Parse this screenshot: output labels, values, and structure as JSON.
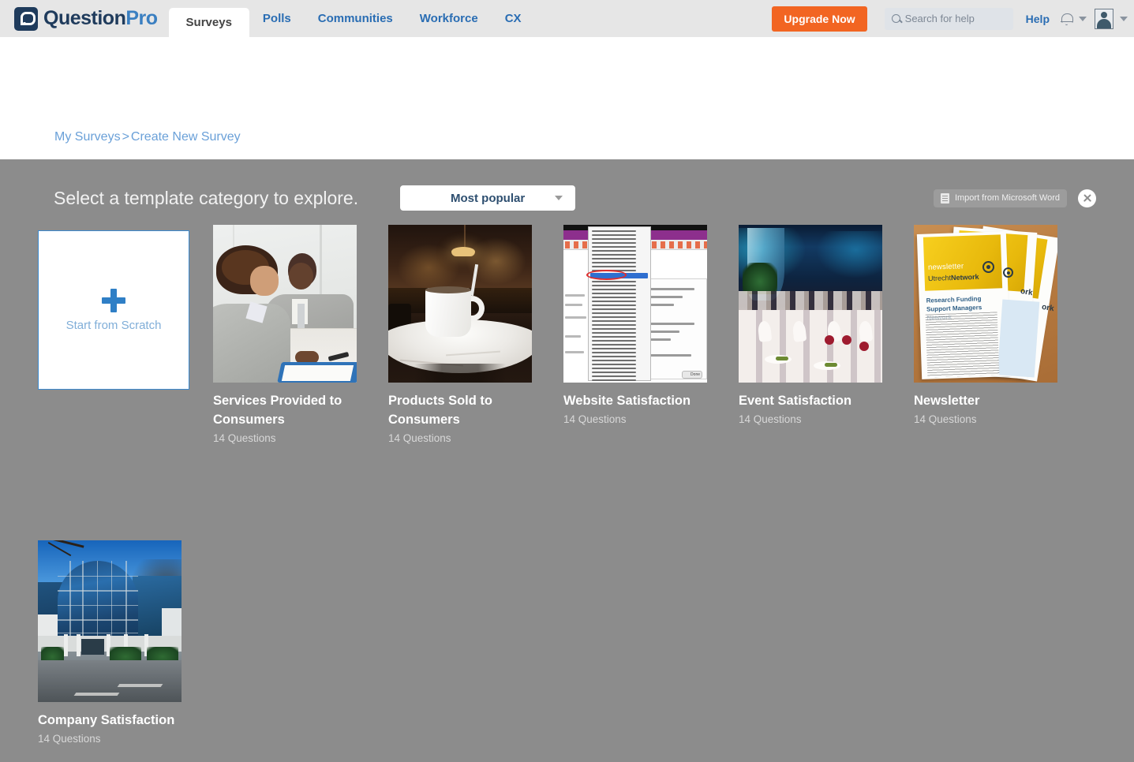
{
  "header": {
    "logo": {
      "part1": "Question",
      "part2": "Pro",
      "icon": "questionpro-logo-icon"
    },
    "nav": [
      {
        "label": "Surveys",
        "active": true
      },
      {
        "label": "Polls",
        "active": false
      },
      {
        "label": "Communities",
        "active": false
      },
      {
        "label": "Workforce",
        "active": false
      },
      {
        "label": "CX",
        "active": false
      }
    ],
    "upgrade_label": "Upgrade Now",
    "search_placeholder": "Search for help",
    "search_value": "",
    "help_label": "Help",
    "accent_orange": "#f26522",
    "link_blue": "#2a6db3"
  },
  "breadcrumb": {
    "root": "My Surveys",
    "separator": ">",
    "current": "Create New Survey"
  },
  "panel": {
    "title": "Select a template category to explore.",
    "sort_selected": "Most popular",
    "import_label": "Import from Microsoft Word",
    "background": "#8c8c8c"
  },
  "scratch": {
    "label": "Start from Scratch"
  },
  "templates": [
    {
      "title": "Services Provided to Consumers",
      "questions": "14 Questions",
      "thumb": "business-meeting-photo"
    },
    {
      "title": "Products Sold to Consumers",
      "questions": "14 Questions",
      "thumb": "coffee-cup-cafe-photo"
    },
    {
      "title": "Website Satisfaction",
      "questions": "14 Questions",
      "thumb": "software-screenshot-photo"
    },
    {
      "title": "Event Satisfaction",
      "questions": "14 Questions",
      "thumb": "banquet-hall-photo"
    },
    {
      "title": "Newsletter",
      "questions": "14 Questions",
      "thumb": "newsletter-print-photo"
    },
    {
      "title": "Company Satisfaction",
      "questions": "14 Questions",
      "thumb": "office-building-photo"
    }
  ],
  "thumb_text": {
    "newsletter_title": "newsletter",
    "newsletter_org_light": "Utrecht",
    "newsletter_org_bold": "Network",
    "newsletter_heading": "Research Funding Support Managers Network",
    "newsletter_edge": "ork",
    "site_done": "Done"
  }
}
